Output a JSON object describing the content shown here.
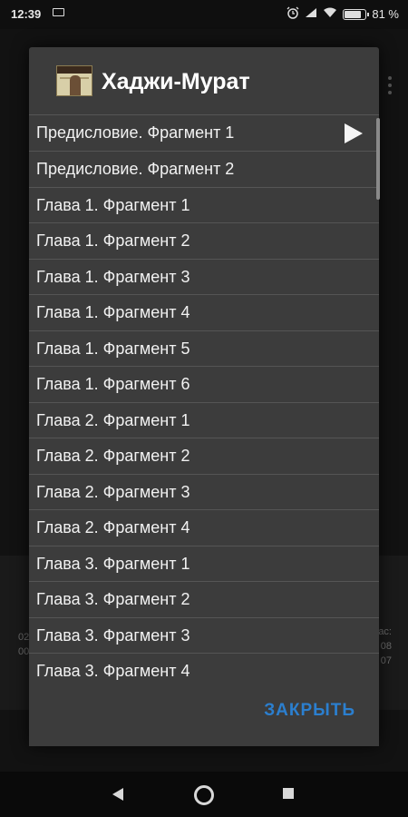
{
  "status_bar": {
    "time": "12:39",
    "battery": "81 %",
    "battery_level": 0.81,
    "icons": [
      "notification-icon",
      "alarm-icon",
      "signal-icon",
      "wifi-icon",
      "battery-icon"
    ]
  },
  "dialog": {
    "title": "Хаджи-Мурат",
    "items": [
      {
        "label": "Предисловие. Фрагмент 1",
        "playing": true
      },
      {
        "label": "Предисловие.  Фрагмент 2"
      },
      {
        "label": "Глава 1. Фрагмент 1"
      },
      {
        "label": "Глава 1. Фрагмент 2"
      },
      {
        "label": "Глава 1. Фрагмент 3"
      },
      {
        "label": "Глава 1. Фрагмент 4"
      },
      {
        "label": "Глава 1. Фрагмент 5"
      },
      {
        "label": "Глава 1. Фрагмент 6"
      },
      {
        "label": "Глава 2. Фрагмент 1"
      },
      {
        "label": "Глава 2. Фрагмент 2"
      },
      {
        "label": "Глава 2. Фрагмент 3"
      },
      {
        "label": "Глава 2. Фрагмент 4"
      },
      {
        "label": "Глава 3. Фрагмент 1"
      },
      {
        "label": "Глава 3. Фрагмент 2"
      },
      {
        "label": "Глава 3. Фрагмент 3"
      },
      {
        "label": "Глава 3. Фрагмент 4"
      }
    ],
    "close_label": "ЗАКРЫТЬ"
  },
  "background": {
    "left_text": [
      "02",
      "00"
    ],
    "right_text": [
      "ас:",
      "08",
      "07"
    ]
  },
  "colors": {
    "accent": "#2b7fcf",
    "dialog_bg": "#3c3c3c"
  }
}
